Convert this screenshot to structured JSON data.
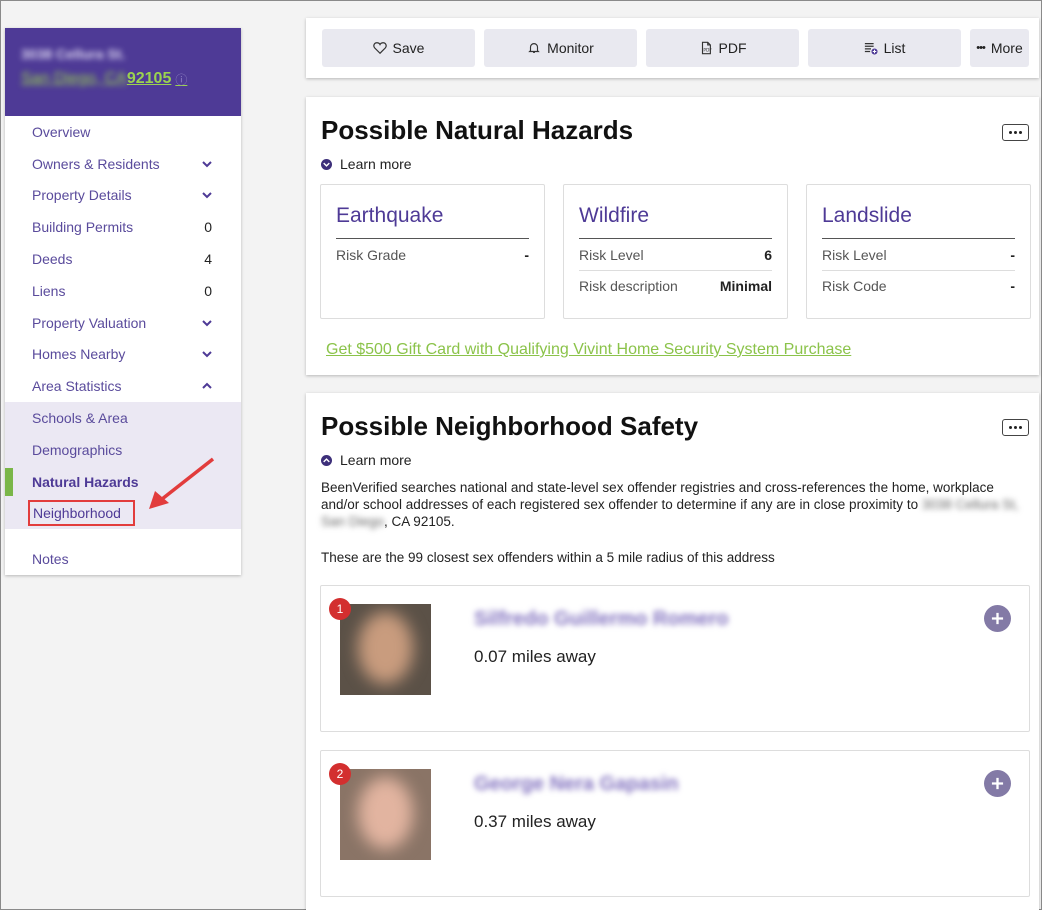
{
  "address": {
    "street": "3038 Cellura St.",
    "city": "San Diego, CA ",
    "zip": "92105"
  },
  "sidebar": {
    "items": [
      {
        "label": "Overview",
        "count": "",
        "chevron": ""
      },
      {
        "label": "Owners & Residents",
        "count": "",
        "chevron": "down"
      },
      {
        "label": "Property Details",
        "count": "",
        "chevron": "down"
      },
      {
        "label": "Building Permits",
        "count": "0",
        "chevron": ""
      },
      {
        "label": "Deeds",
        "count": "4",
        "chevron": ""
      },
      {
        "label": "Liens",
        "count": "0",
        "chevron": ""
      },
      {
        "label": "Property Valuation",
        "count": "",
        "chevron": "down"
      },
      {
        "label": "Homes Nearby",
        "count": "",
        "chevron": "down"
      },
      {
        "label": "Area Statistics",
        "count": "",
        "chevron": "up"
      }
    ],
    "sub_items": [
      {
        "label": "Schools & Area"
      },
      {
        "label": "Demographics"
      },
      {
        "label": "Natural Hazards"
      },
      {
        "label": "Neighborhood"
      }
    ],
    "notes": "Notes"
  },
  "toolbar": {
    "save": "Save",
    "monitor": "Monitor",
    "pdf": "PDF",
    "list": "List",
    "more": "More"
  },
  "hazards": {
    "title": "Possible Natural Hazards",
    "learn_more": "Learn more",
    "cards": [
      {
        "title": "Earthquake",
        "rows": [
          {
            "label": "Risk Grade",
            "value": "-"
          }
        ]
      },
      {
        "title": "Wildfire",
        "rows": [
          {
            "label": "Risk Level",
            "value": "6"
          },
          {
            "label": "Risk description",
            "value": "Minimal"
          }
        ]
      },
      {
        "title": "Landslide",
        "rows": [
          {
            "label": "Risk Level",
            "value": "-"
          },
          {
            "label": "Risk Code",
            "value": "-"
          }
        ]
      }
    ],
    "promo": "Get $500 Gift Card with Qualifying Vivint Home Security System Purchase"
  },
  "safety": {
    "title": "Possible Neighborhood Safety",
    "learn_more": "Learn more",
    "desc_main": "BeenVerified searches national and state-level sex offender registries and cross-references the home, workplace and/or school addresses of each registered sex offender to determine if any are in close proximity to ",
    "desc_addr_blur": "3038 Cellura St, San Diego",
    "desc_end": ", CA 92105.",
    "closest": "These are the 99 closest sex offenders within a 5 mile radius of this address",
    "offenders": [
      {
        "rank": "1",
        "name": "Silfredo Guillermo Romero",
        "distance": "0.07 miles away"
      },
      {
        "rank": "2",
        "name": "George Nera Gapasin",
        "distance": "0.37 miles away"
      }
    ]
  },
  "colors": {
    "brand_purple": "#4e3a96",
    "accent_green": "#7ab648",
    "highlight_red": "#e23c3c"
  }
}
